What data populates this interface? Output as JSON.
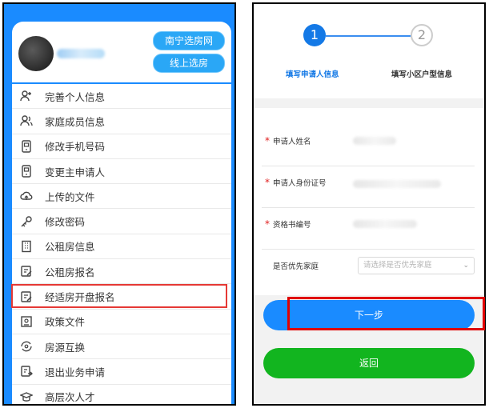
{
  "left": {
    "buttons": {
      "btn1": "南宁选房网",
      "btn2": "线上选房"
    },
    "menu": [
      {
        "label": "完善个人信息",
        "icon": "user-add-icon"
      },
      {
        "label": "家庭成员信息",
        "icon": "users-icon"
      },
      {
        "label": "修改手机号码",
        "icon": "phone-icon"
      },
      {
        "label": "变更主申请人",
        "icon": "phone-icon"
      },
      {
        "label": "上传的文件",
        "icon": "cloud-upload-icon"
      },
      {
        "label": "修改密码",
        "icon": "key-icon"
      },
      {
        "label": "公租房信息",
        "icon": "building-icon"
      },
      {
        "label": "公租房报名",
        "icon": "edit-form-icon"
      },
      {
        "label": "经适房开盘报名",
        "icon": "edit-form-icon"
      },
      {
        "label": "政策文件",
        "icon": "document-icon"
      },
      {
        "label": "房源互换",
        "icon": "exchange-icon"
      },
      {
        "label": "退出业务申请",
        "icon": "exit-form-icon"
      },
      {
        "label": "高层次人才",
        "icon": "graduation-icon"
      }
    ]
  },
  "right": {
    "steps": [
      {
        "num": "1",
        "label": "填写申请人信息"
      },
      {
        "num": "2",
        "label": "填写小区户型信息"
      }
    ],
    "form": {
      "name_label": "申请人姓名",
      "id_label": "申请人身份证号",
      "cert_label": "资格书编号",
      "priority_label": "是否优先家庭",
      "priority_placeholder": "请选择是否优先家庭",
      "required_mark": "*"
    },
    "next_button": "下一步",
    "back_button": "返回"
  }
}
